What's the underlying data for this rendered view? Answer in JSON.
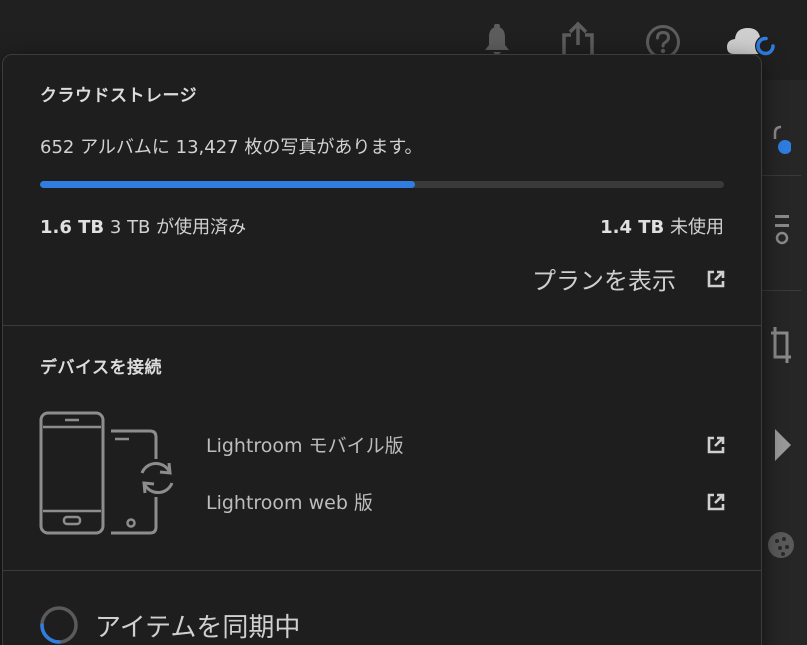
{
  "storage": {
    "heading": "クラウドストレージ",
    "summary": "652 アルバムに 13,427 枚の写真があります。",
    "used_fraction": 0.548,
    "used_amount": "1.6 TB",
    "used_of": "3 TB が使用済み",
    "free_amount": "1.4 TB",
    "free_label": "未使用",
    "plan_link": "プランを表示"
  },
  "devices": {
    "heading": "デバイスを接続",
    "links": [
      {
        "label": "Lightroom モバイル版"
      },
      {
        "label": "Lightroom web 版"
      }
    ]
  },
  "sync": {
    "label": "アイテムを同期中"
  },
  "colors": {
    "accent": "#2f7de1",
    "panel_bg": "#1e1e1e",
    "track": "#3a3a3a"
  },
  "icons": [
    "bell-icon",
    "share-icon",
    "help-icon",
    "cloud-sync-icon",
    "external-link-icon",
    "devices-sync-icon",
    "spinner-icon"
  ]
}
